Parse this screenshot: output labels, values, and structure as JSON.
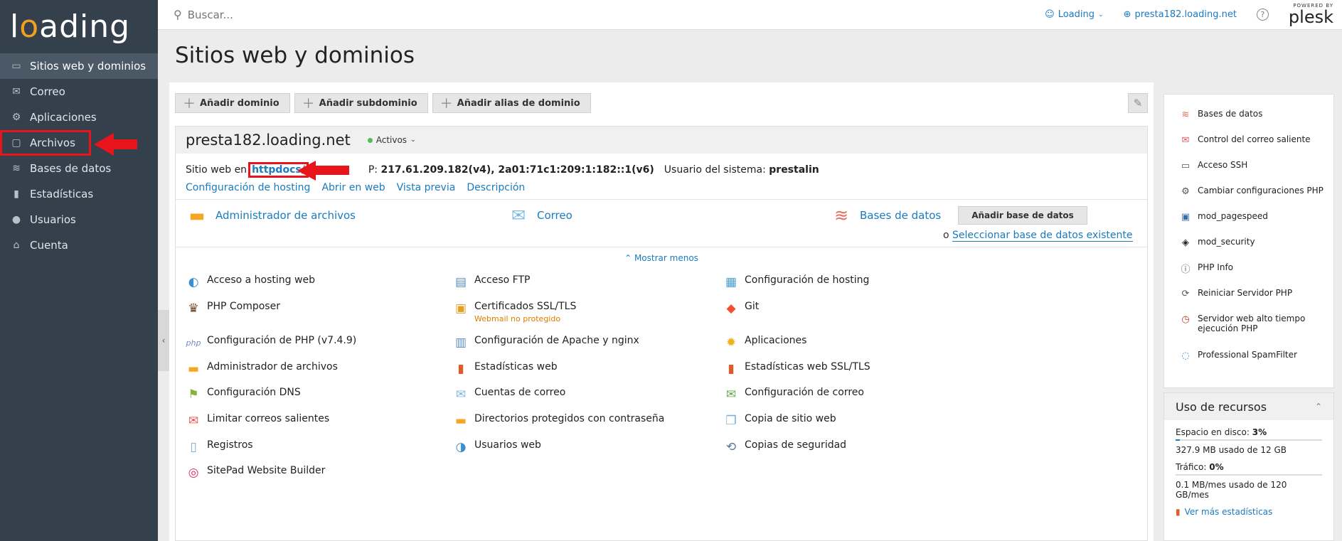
{
  "logo": {
    "text_pre": "l",
    "text_o": "o",
    "text_post": "ading"
  },
  "sidebar": {
    "items": [
      {
        "label": "Sitios web y dominios",
        "icon": "monitor-icon"
      },
      {
        "label": "Correo",
        "icon": "mail-icon"
      },
      {
        "label": "Aplicaciones",
        "icon": "gear-icon"
      },
      {
        "label": "Archivos",
        "icon": "folder-icon"
      },
      {
        "label": "Bases de datos",
        "icon": "database-icon"
      },
      {
        "label": "Estadísticas",
        "icon": "chart-icon"
      },
      {
        "label": "Usuarios",
        "icon": "user-icon"
      },
      {
        "label": "Cuenta",
        "icon": "account-icon"
      }
    ]
  },
  "topbar": {
    "search_placeholder": "Buscar...",
    "user_label": "Loading",
    "domain_label": "presta182.loading.net",
    "help": "?",
    "powered_by": "POWERED BY",
    "brand": "plesk"
  },
  "page": {
    "title": "Sitios web y dominios"
  },
  "toolbar": {
    "add_domain": "Añadir dominio",
    "add_subdomain": "Añadir subdominio",
    "add_alias": "Añadir alias de dominio"
  },
  "domain": {
    "name": "presta182.loading.net",
    "status": "Activos",
    "site_at": "Sitio web en",
    "httpdocs": "httpdocs/",
    "ip_label": "P:",
    "ip_value": "217.61.209.182(v4), 2a01:71c1:209:1:182::1(v6)",
    "sys_user_label": "Usuario del sistema:",
    "sys_user": "prestalin",
    "links": [
      "Configuración de hosting",
      "Abrir en web",
      "Vista previa",
      "Descripción"
    ]
  },
  "quick": {
    "files": "Administrador de archivos",
    "mail": "Correo",
    "db": "Bases de datos",
    "add_db": "Añadir base de datos",
    "or": "o",
    "select_db": "Seleccionar base de datos existente"
  },
  "toggle": "Mostrar menos",
  "tools": [
    {
      "label": "Acceso a hosting web",
      "icon": "globe-icon"
    },
    {
      "label": "Acceso FTP",
      "icon": "ftp-icon"
    },
    {
      "label": "Configuración de hosting",
      "icon": "hosting-config-icon"
    },
    {
      "label": "PHP Composer",
      "icon": "composer-icon"
    },
    {
      "label": "Certificados SSL/TLS",
      "icon": "lock-icon",
      "sub": "Webmail no protegido"
    },
    {
      "label": "Git",
      "icon": "git-icon"
    },
    {
      "label": "Configuración de PHP (v7.4.9)",
      "icon": "php-icon"
    },
    {
      "label": "Configuración de Apache y nginx",
      "icon": "server-icon"
    },
    {
      "label": "Aplicaciones",
      "icon": "sun-gear-icon"
    },
    {
      "label": "Administrador de archivos",
      "icon": "folder-icon"
    },
    {
      "label": "Estadísticas web",
      "icon": "bar-chart-icon"
    },
    {
      "label": "Estadísticas web SSL/TLS",
      "icon": "bar-chart-lock-icon"
    },
    {
      "label": "Configuración DNS",
      "icon": "dns-icon"
    },
    {
      "label": "Cuentas de correo",
      "icon": "envelope-icon"
    },
    {
      "label": "Configuración de correo",
      "icon": "mail-settings-icon"
    },
    {
      "label": "Limitar correos salientes",
      "icon": "mail-limit-icon"
    },
    {
      "label": "Directorios protegidos con contraseña",
      "icon": "protected-folder-icon"
    },
    {
      "label": "Copia de sitio web",
      "icon": "copy-icon"
    },
    {
      "label": "Registros",
      "icon": "log-icon"
    },
    {
      "label": "Usuarios web",
      "icon": "web-users-icon"
    },
    {
      "label": "Copias de seguridad",
      "icon": "backup-icon"
    },
    {
      "label": "SitePad Website Builder",
      "icon": "sitepad-icon"
    }
  ],
  "right_panel": [
    {
      "label": "Bases de datos",
      "icon": "database-icon"
    },
    {
      "label": "Control del correo saliente",
      "icon": "mail-control-icon"
    },
    {
      "label": "Acceso SSH",
      "icon": "terminal-icon"
    },
    {
      "label": "Cambiar configuraciones PHP",
      "icon": "php-settings-icon"
    },
    {
      "label": "mod_pagespeed",
      "icon": "pagespeed-icon"
    },
    {
      "label": "mod_security",
      "icon": "shield-icon"
    },
    {
      "label": "PHP Info",
      "icon": "info-icon"
    },
    {
      "label": "Reiniciar Servidor PHP",
      "icon": "restart-icon"
    },
    {
      "label": "Servidor web alto tiempo ejecución PHP",
      "icon": "clock-icon"
    },
    {
      "label": "Professional SpamFilter",
      "icon": "spam-filter-icon"
    }
  ],
  "resources": {
    "title": "Uso de recursos",
    "disk_label": "Espacio en disco:",
    "disk_pct": "3%",
    "disk_fraction": 0.03,
    "disk_detail": "327.9 MB usado de 12 GB",
    "traffic_label": "Tráfico:",
    "traffic_pct": "0%",
    "traffic_fraction": 0.0,
    "traffic_detail": "0.1 MB/mes usado de 120 GB/mes",
    "more": "Ver más estadísticas"
  },
  "colors": {
    "accent": "#1a7bbf",
    "sidebar": "#34404c",
    "highlight": "#e8141b",
    "warning": "#e07b00"
  }
}
